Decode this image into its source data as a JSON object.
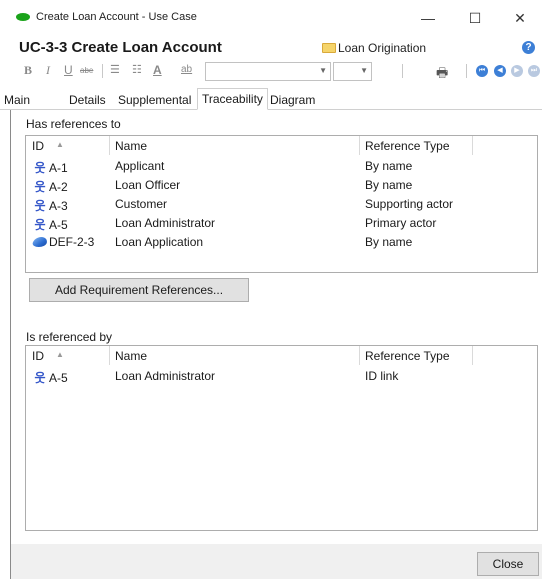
{
  "window": {
    "title": "Create Loan Account - Use Case",
    "minimize": "—",
    "maximize": "☐",
    "close": "✕"
  },
  "header": {
    "doc_title": "UC-3-3 Create Loan Account",
    "package": "Loan Origination",
    "help": "?"
  },
  "format_toolbar": {
    "bold": "B",
    "italic": "I",
    "underline": "U",
    "strike": "abe",
    "bullets": "☰",
    "numbered": "☷",
    "font_color": "A",
    "highlight": "ab",
    "font_name": "",
    "font_size": ""
  },
  "tabs": [
    {
      "label": "Main"
    },
    {
      "label": "Details"
    },
    {
      "label": "Supplemental"
    },
    {
      "label": "Traceability",
      "active": true
    },
    {
      "label": "Diagram"
    }
  ],
  "has_references": {
    "label": "Has references to",
    "columns": {
      "id": "ID",
      "name": "Name",
      "reference_type": "Reference Type"
    },
    "rows": [
      {
        "icon": "actor-icon",
        "id": "A-1",
        "name": "Applicant",
        "ref": "By name"
      },
      {
        "icon": "actor-icon",
        "id": "A-2",
        "name": "Loan Officer",
        "ref": "By name"
      },
      {
        "icon": "actor-icon",
        "id": "A-3",
        "name": "Customer",
        "ref": "Supporting actor"
      },
      {
        "icon": "actor-icon",
        "id": "A-5",
        "name": "Loan Administrator",
        "ref": "Primary actor"
      },
      {
        "icon": "definition-icon",
        "id": "DEF-2-3",
        "name": "Loan Application",
        "ref": "By name"
      }
    ],
    "add_button": "Add Requirement References..."
  },
  "referenced_by": {
    "label": "Is referenced by",
    "columns": {
      "id": "ID",
      "name": "Name",
      "reference_type": "Reference Type"
    },
    "rows": [
      {
        "icon": "actor-icon",
        "id": "A-5",
        "name": "Loan Administrator",
        "ref": "ID link"
      }
    ]
  },
  "footer": {
    "close_button": "Close"
  },
  "colors": {
    "actor_icon": "#3557c9",
    "status_dot": "#1aa31a",
    "nav_active": "#3d7fd6"
  }
}
